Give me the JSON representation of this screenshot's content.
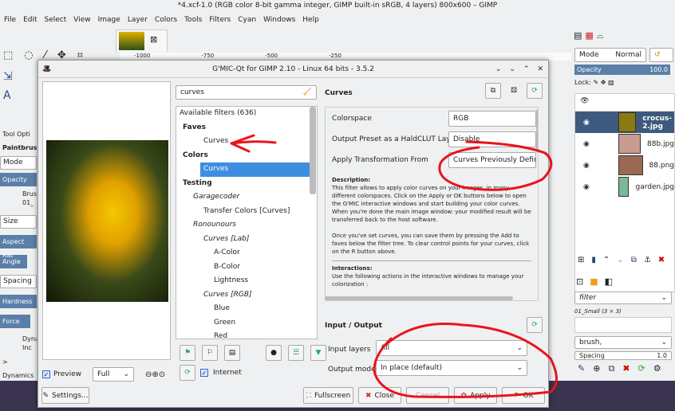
{
  "gimp": {
    "title": "*4.xcf-1.0 (RGB color 8-bit gamma integer, GIMP built-in sRGB, 4 layers) 800x600 – GIMP",
    "menu": [
      "File",
      "Edit",
      "Select",
      "View",
      "Image",
      "Layer",
      "Colors",
      "Tools",
      "Filters",
      "Cyan",
      "Windows",
      "Help"
    ],
    "ruler": [
      "-1000",
      "-750",
      "-500",
      "-250"
    ],
    "tool_options": {
      "title": "Tool Opti",
      "tool": "Paintbrush",
      "mode": "Mode",
      "opacity": "Opacity",
      "brush": "Brus",
      "brush_val": "01_",
      "size": "Size",
      "aspect": "Aspect Rat",
      "angle": "Angle",
      "spacing": "Spacing",
      "hardness": "Hardness",
      "force": "Force",
      "dyn": "Dyna",
      "dyn_val": "Inc",
      "dynamics": "> Dynamics"
    },
    "layers": {
      "mode_label": "Mode",
      "mode_value": "Normal",
      "opacity_label": "Opacity",
      "opacity_value": "100.0",
      "lock": "Lock:",
      "items": [
        {
          "name": "crocus-2.jpg",
          "thumb": "#8a7a10"
        },
        {
          "name": "88b.jpg",
          "thumb": "#c89a90"
        },
        {
          "name": "88.png",
          "thumb": "#9a6a50"
        },
        {
          "name": "garden.jpg",
          "thumb": "#7ab89a"
        }
      ]
    },
    "brushes": {
      "filter": "filter",
      "brush_name": "01_Small (3 × 3)",
      "brush_tag": "brush,",
      "spacing_label": "Spacing",
      "spacing_value": "1.0"
    }
  },
  "dialog": {
    "title": "G'MIC-Qt for GIMP 2.10 - Linux 64 bits - 3.5.2",
    "search_value": "curves",
    "available": "Available filters (636)",
    "tree": [
      {
        "label": "Faves",
        "level": 0,
        "bold": true
      },
      {
        "label": "Curves",
        "level": 2
      },
      {
        "label": "Colors",
        "level": 0,
        "bold": true
      },
      {
        "label": "Curves",
        "level": 2,
        "selected": true
      },
      {
        "label": "Testing",
        "level": 0,
        "bold": true
      },
      {
        "label": "Garagecoder",
        "level": 1,
        "italic": true
      },
      {
        "label": "Transfer Colors [Curves]",
        "level": 2
      },
      {
        "label": "Ronounours",
        "level": 1,
        "italic": true
      },
      {
        "label": "Curves [Lab]",
        "level": 2,
        "italic": true
      },
      {
        "label": "A-Color",
        "level": 3
      },
      {
        "label": "B-Color",
        "level": 3
      },
      {
        "label": "Lightness",
        "level": 3
      },
      {
        "label": "Curves [RGB]",
        "level": 2,
        "italic": true
      },
      {
        "label": "Blue",
        "level": 3
      },
      {
        "label": "Green",
        "level": 3
      },
      {
        "label": "Red",
        "level": 3
      }
    ],
    "filter_name": "Curves",
    "params": [
      {
        "label": "Colorspace",
        "value": "RGB"
      },
      {
        "label": "Output Preset as a HaldCLUT Layer",
        "value": "Disable"
      },
      {
        "label": "Apply Transformation From",
        "value": "Curves Previously Define"
      }
    ],
    "description_title": "Description:",
    "description": "This filter allows to apply color curves on your images, in many different colorspaces. Click on the Apply or OK buttons below to open the G'MIC interactive windows and start building your color curves. When you're done the main image window: your modified result will be transferred back to the host software.",
    "description2": "Once you've set curves, you can save them by pressing the Add to faves below the filter tree. To clear control points for your curves, click on the R button above.",
    "interactions_title": "Interactions:",
    "interactions": "Use the following actions in the interactive windows to manage your colorization :",
    "io_title": "Input / Output",
    "input_label": "Input layers",
    "input_value": "All",
    "output_label": "Output mode",
    "output_value": "In place (default)",
    "preview_label": "Preview",
    "preview_mode": "Full",
    "internet_label": "Internet",
    "buttons": {
      "settings": "Settings...",
      "fullscreen": "Fullscreen",
      "close": "Close",
      "cancel": "Cancel",
      "apply": "Apply",
      "ok": "OK"
    },
    "annotation_color": "#e8141c"
  }
}
